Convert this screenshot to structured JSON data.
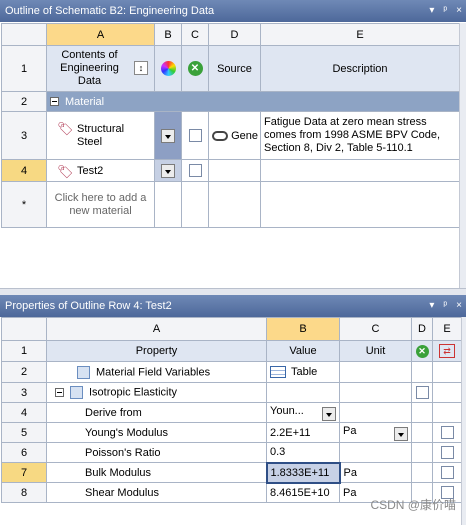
{
  "top_panel": {
    "title": "Outline of Schematic B2: Engineering Data",
    "controls": [
      "▾",
      "ᵖ",
      "×"
    ],
    "col_headers": [
      "A",
      "B",
      "C",
      "D",
      "E"
    ],
    "header_row": {
      "num": "1",
      "a": "Contents of Engineering Data",
      "d": "Source",
      "e": "Description"
    },
    "group_row": {
      "num": "2",
      "label": "Material"
    },
    "rows": [
      {
        "num": "3",
        "name": "Structural Steel",
        "source": "Gene",
        "description": "Fatigue Data at zero mean stress comes from 1998 ASME BPV Code, Section 8, Div 2, Table 5-110.1"
      },
      {
        "num": "4",
        "name": "Test2",
        "source": "",
        "description": ""
      }
    ],
    "add_row": {
      "num": "*",
      "label": "Click here to add a new material"
    }
  },
  "bottom_panel": {
    "title": "Properties of Outline Row 4: Test2",
    "controls": [
      "▾",
      "ᵖ",
      "×"
    ],
    "col_headers": [
      "A",
      "B",
      "C",
      "D",
      "E"
    ],
    "header_row": {
      "num": "1",
      "property": "Property",
      "value": "Value",
      "unit": "Unit"
    },
    "rows": [
      {
        "num": "2",
        "property": "Material Field Variables",
        "value": "Table",
        "unit": ""
      },
      {
        "num": "3",
        "property": "Isotropic Elasticity",
        "value": "",
        "unit": ""
      },
      {
        "num": "4",
        "property": "Derive from",
        "value": "Youn...",
        "unit": ""
      },
      {
        "num": "5",
        "property": "Young's Modulus",
        "value": "2.2E+11",
        "unit": "Pa"
      },
      {
        "num": "6",
        "property": "Poisson's Ratio",
        "value": "0.3",
        "unit": ""
      },
      {
        "num": "7",
        "property": "Bulk Modulus",
        "value": "1.8333E+11",
        "unit": "Pa"
      },
      {
        "num": "8",
        "property": "Shear Modulus",
        "value": "8.4615E+10",
        "unit": "Pa"
      }
    ]
  },
  "watermark": "CSDN @康价喵"
}
